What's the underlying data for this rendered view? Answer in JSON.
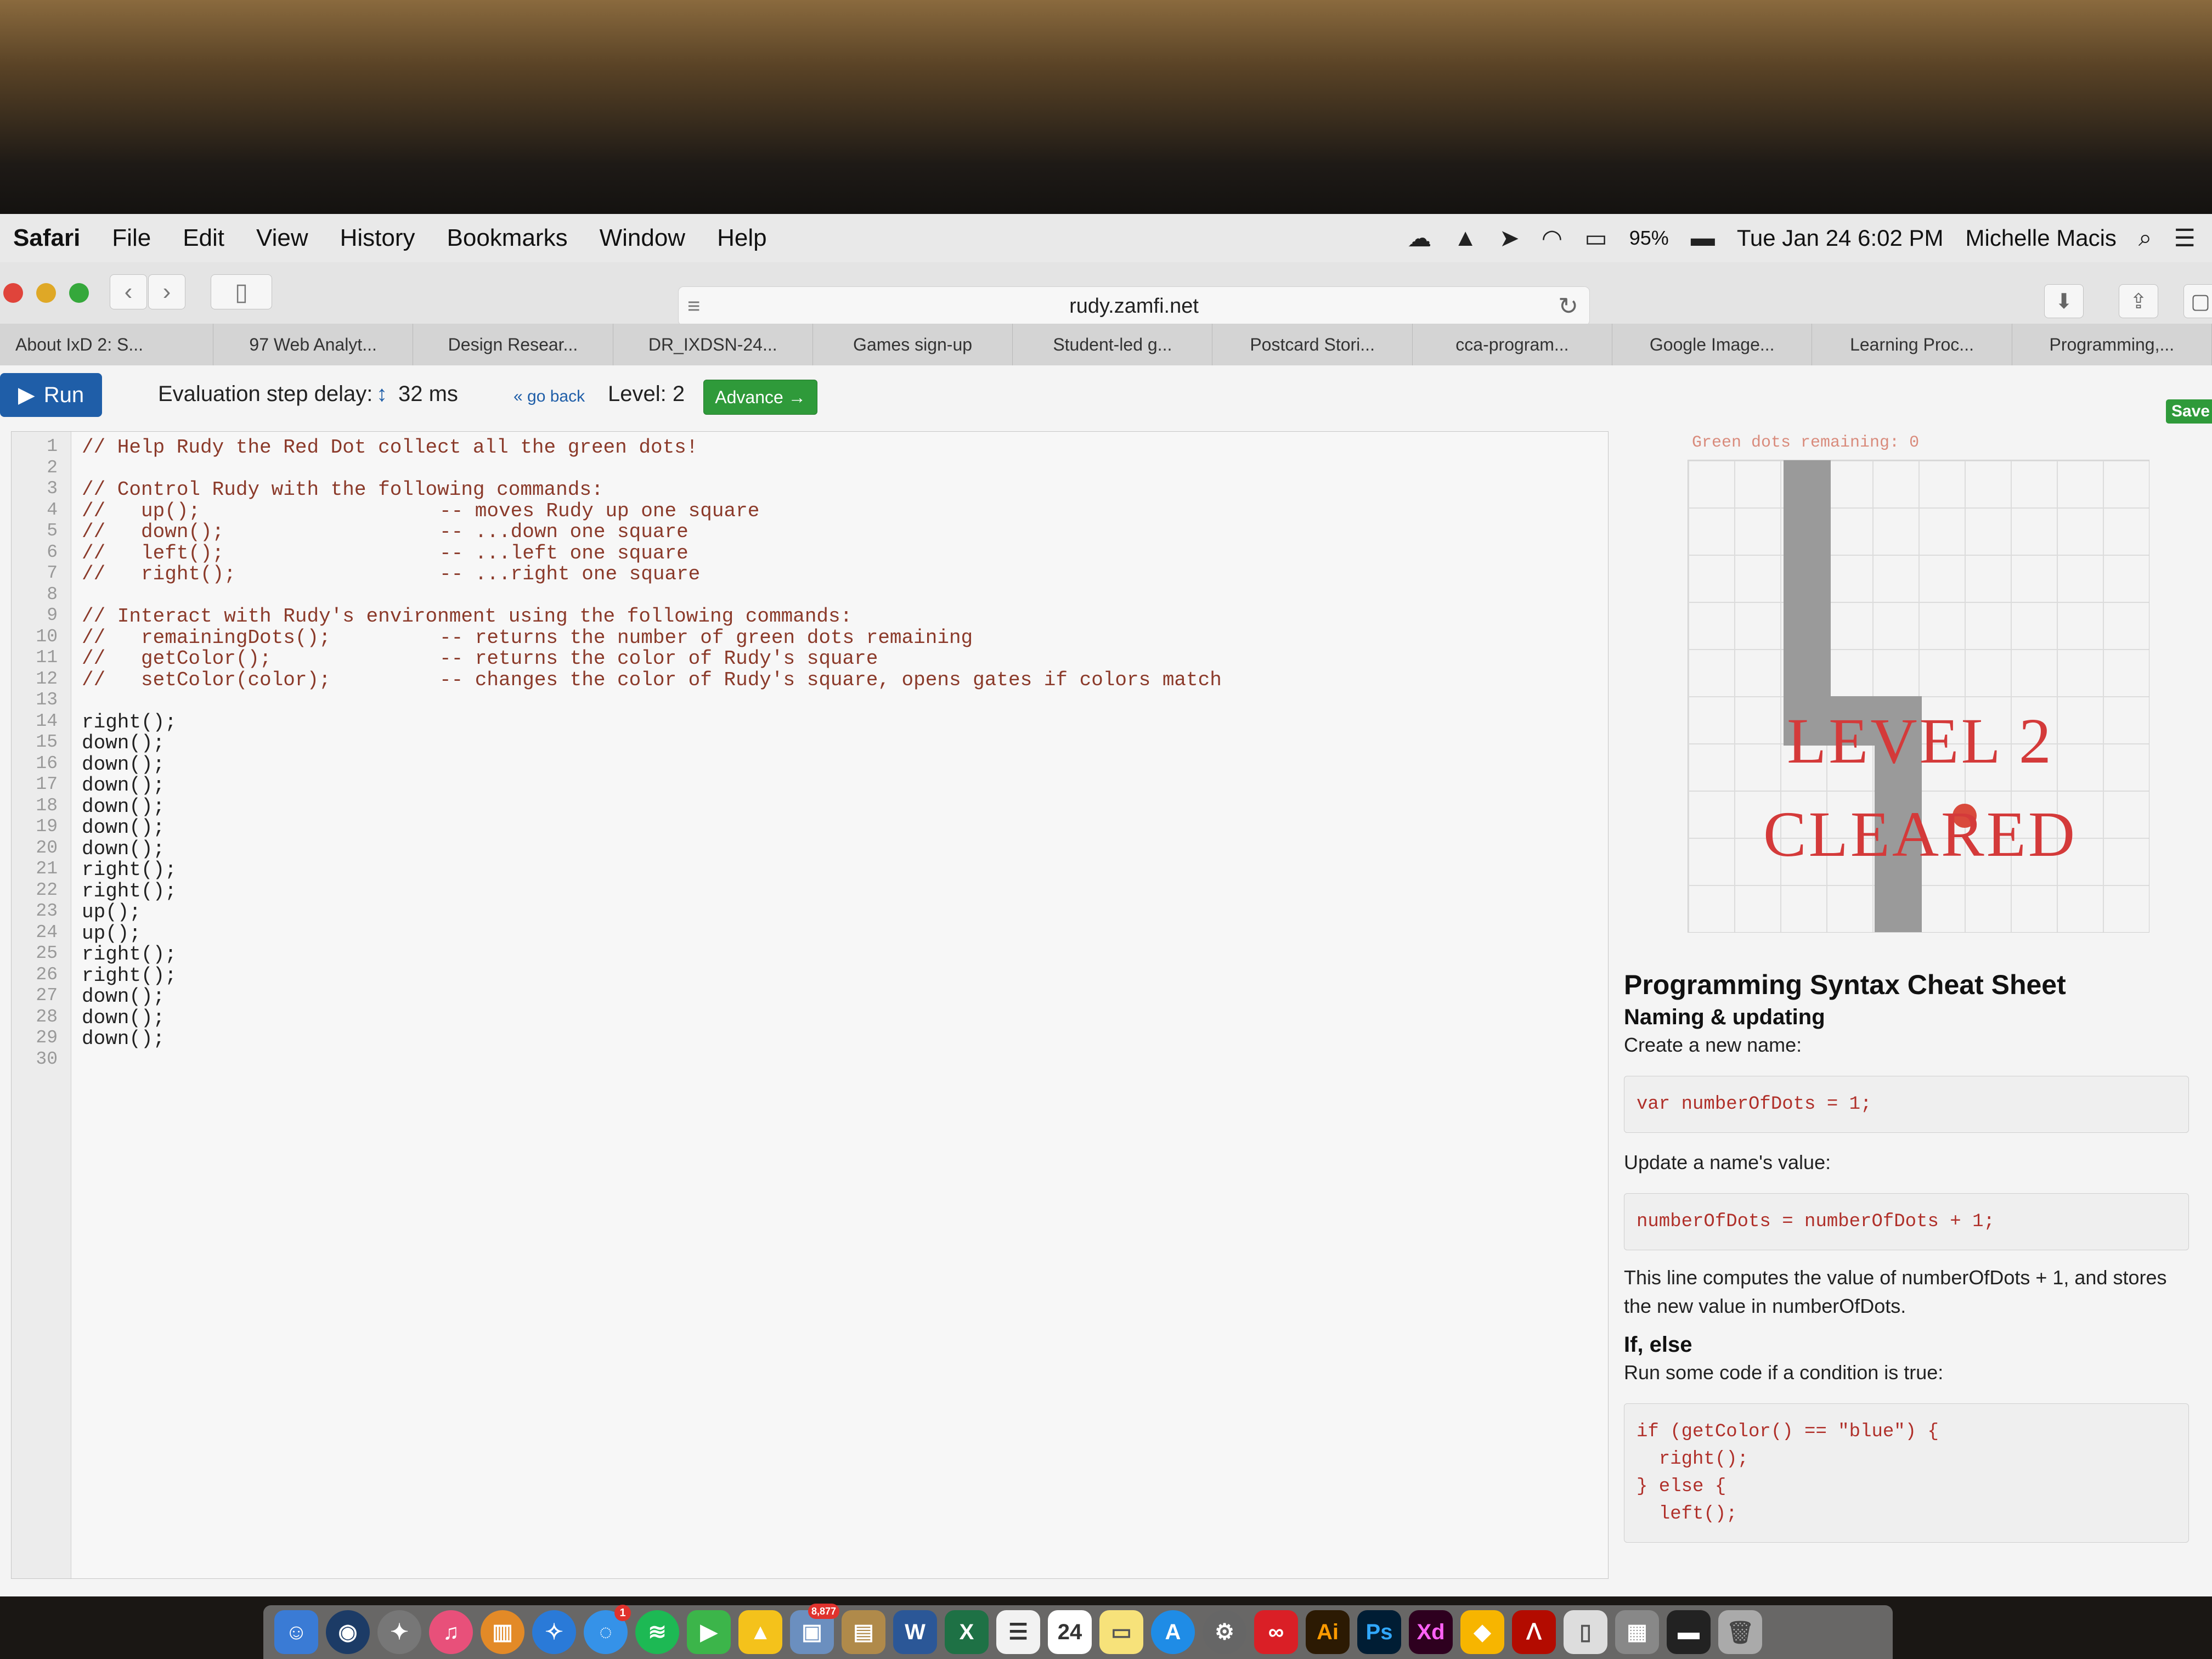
{
  "menubar": {
    "app": "Safari",
    "items": [
      "File",
      "Edit",
      "View",
      "History",
      "Bookmarks",
      "Window",
      "Help"
    ],
    "battery": "95%",
    "datetime": "Tue Jan 24  6:02 PM",
    "user": "Michelle Macis"
  },
  "toolbar": {
    "url": "rudy.zamfi.net"
  },
  "tabs": [
    "About IxD 2: S...",
    "97 Web Analyt...",
    "Design Resear...",
    "DR_IXDSN-24...",
    "Games sign-up",
    "Student-led g...",
    "Postcard Stori...",
    "cca-program...",
    "Google Image...",
    "Learning Proc...",
    "Programming,..."
  ],
  "controls": {
    "run_label": "Run",
    "delay_label": "Evaluation step delay:",
    "delay_value": "32 ms",
    "go_back": "« go back",
    "level_label": "Level: 2",
    "advance_label": "Advance →",
    "save_label": "Save"
  },
  "editor": {
    "line_numbers": [
      "1",
      "2",
      "3",
      "4",
      "5",
      "6",
      "7",
      "8",
      "9",
      "10",
      "11",
      "12",
      "13",
      "14",
      "15",
      "16",
      "17",
      "18",
      "19",
      "20",
      "21",
      "22",
      "23",
      "24",
      "25",
      "26",
      "27",
      "28",
      "29",
      "30"
    ],
    "lines": [
      "// Help Rudy the Red Dot collect all the green dots!",
      "",
      "// Control Rudy with the following commands:",
      "//   up();",
      "//   down();",
      "//   left();",
      "//   right();",
      "",
      "// Interact with Rudy's environment using the following commands:",
      "//   remainingDots();",
      "//   getColor();",
      "//   setColor(color);",
      "",
      "right();",
      "down();",
      "down();",
      "down();",
      "down();",
      "down();",
      "down();",
      "right();",
      "right();",
      "up();",
      "up();",
      "right();",
      "right();",
      "down();",
      "down();",
      "down();",
      ""
    ],
    "descriptions": [
      "-- moves Rudy up one square",
      "-- ...down one square",
      "-- ...left one square",
      "-- ...right one square",
      "-- returns the number of green dots remaining",
      "-- returns the color of Rudy's square",
      "-- changes the color of Rudy's square, opens gates if colors match"
    ]
  },
  "game": {
    "remaining_text": "Green dots remaining: 0",
    "cleared_line1": "LEVEL 2",
    "cleared_line2": "CLEARED"
  },
  "cheatsheet": {
    "title": "Programming Syntax Cheat Sheet",
    "s1_title": "Naming & updating",
    "s1_text": "Create a new name:",
    "s1_code": "var numberOfDots = 1;",
    "s1_text2": "Update a name's value:",
    "s1_code2": "numberOfDots = numberOfDots + 1;",
    "s1_text3": "This line computes the value of numberOfDots + 1, and stores the new value in numberOfDots.",
    "s2_title": "If, else",
    "s2_text": "Run some code if a condition is true:",
    "s2_code": "if (getColor() == \"blue\") {\n  right();\n} else {\n  left();"
  },
  "dock": {
    "badge_mail": "1",
    "badge_photos": "8,877",
    "calendar_day": "24",
    "ai": "Ai",
    "ps": "Ps",
    "xd": "Xd"
  }
}
